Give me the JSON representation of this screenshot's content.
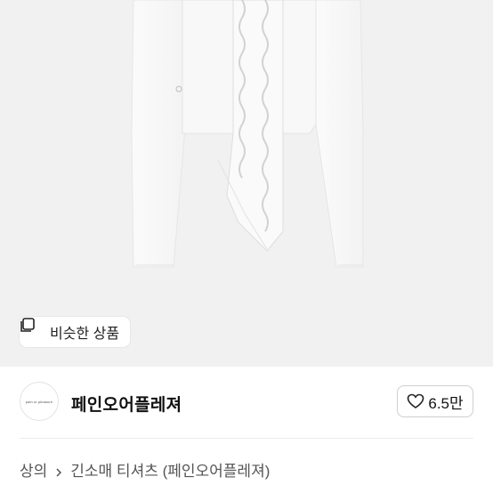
{
  "product_image": {
    "similar_button_label": "비슷한 상품",
    "icon": "similar-items-icon"
  },
  "shop": {
    "logo_text": "pain or pleasure",
    "name": "페인오어플레져",
    "like_count": "6.5만",
    "like_icon": "heart-icon"
  },
  "breadcrumb": {
    "category": "상의",
    "separator_icon": "chevron-right-icon",
    "subcategory": "긴소매 티셔츠 (페인오어플레져)"
  }
}
